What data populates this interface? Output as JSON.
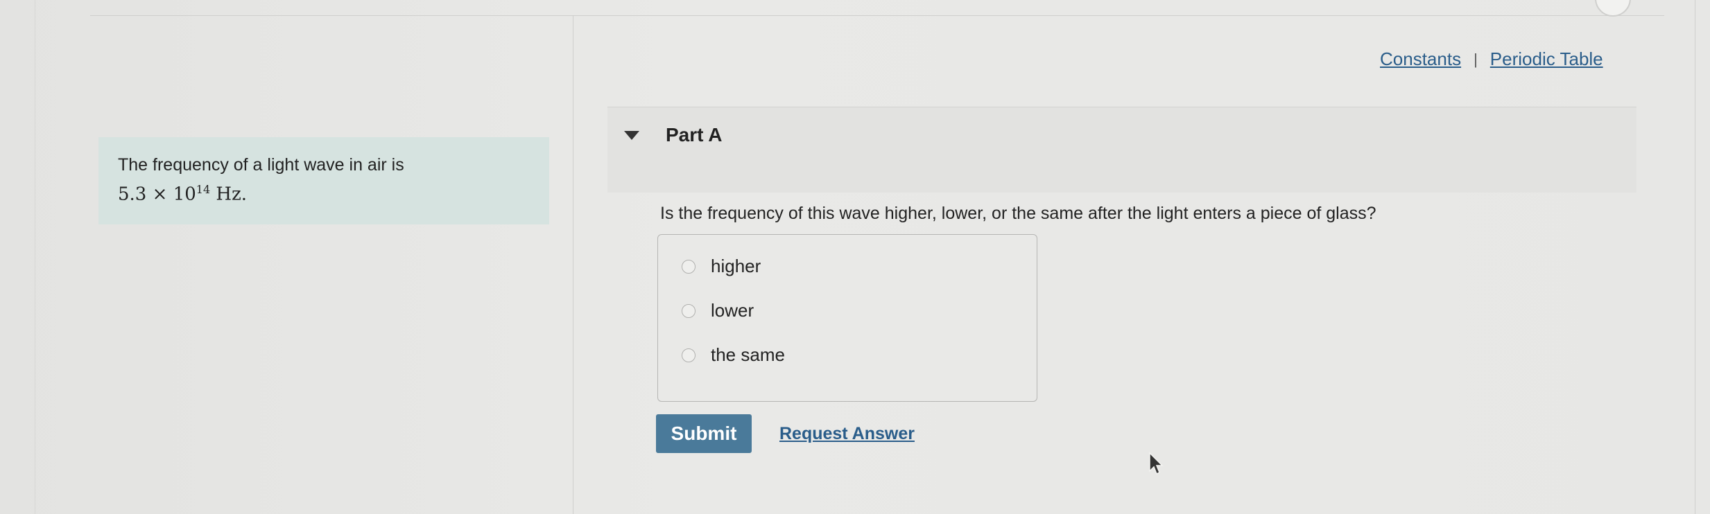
{
  "header": {
    "constants_link": "Constants",
    "separator": "|",
    "periodic_table_link": "Periodic Table"
  },
  "problem": {
    "intro": "The frequency of a light wave in air is",
    "value_mantissa": "5.3",
    "times": "×",
    "value_base": "10",
    "value_exponent": "14",
    "value_unit": "Hz",
    "period": "."
  },
  "part": {
    "title": "Part A",
    "question": "Is the frequency of this wave higher, lower, or the same after the light enters a piece of glass?",
    "choices": [
      {
        "label": "higher"
      },
      {
        "label": "lower"
      },
      {
        "label": "the same"
      }
    ],
    "submit_label": "Submit",
    "request_answer_label": "Request Answer"
  },
  "colors": {
    "accent_link": "#2a5d8a",
    "submit_bg": "#4a7a9a",
    "problem_bg": "#d6e3e0"
  },
  "icons": {
    "part_toggle": "triangle-down-icon",
    "cursor": "mouse-pointer-icon"
  }
}
